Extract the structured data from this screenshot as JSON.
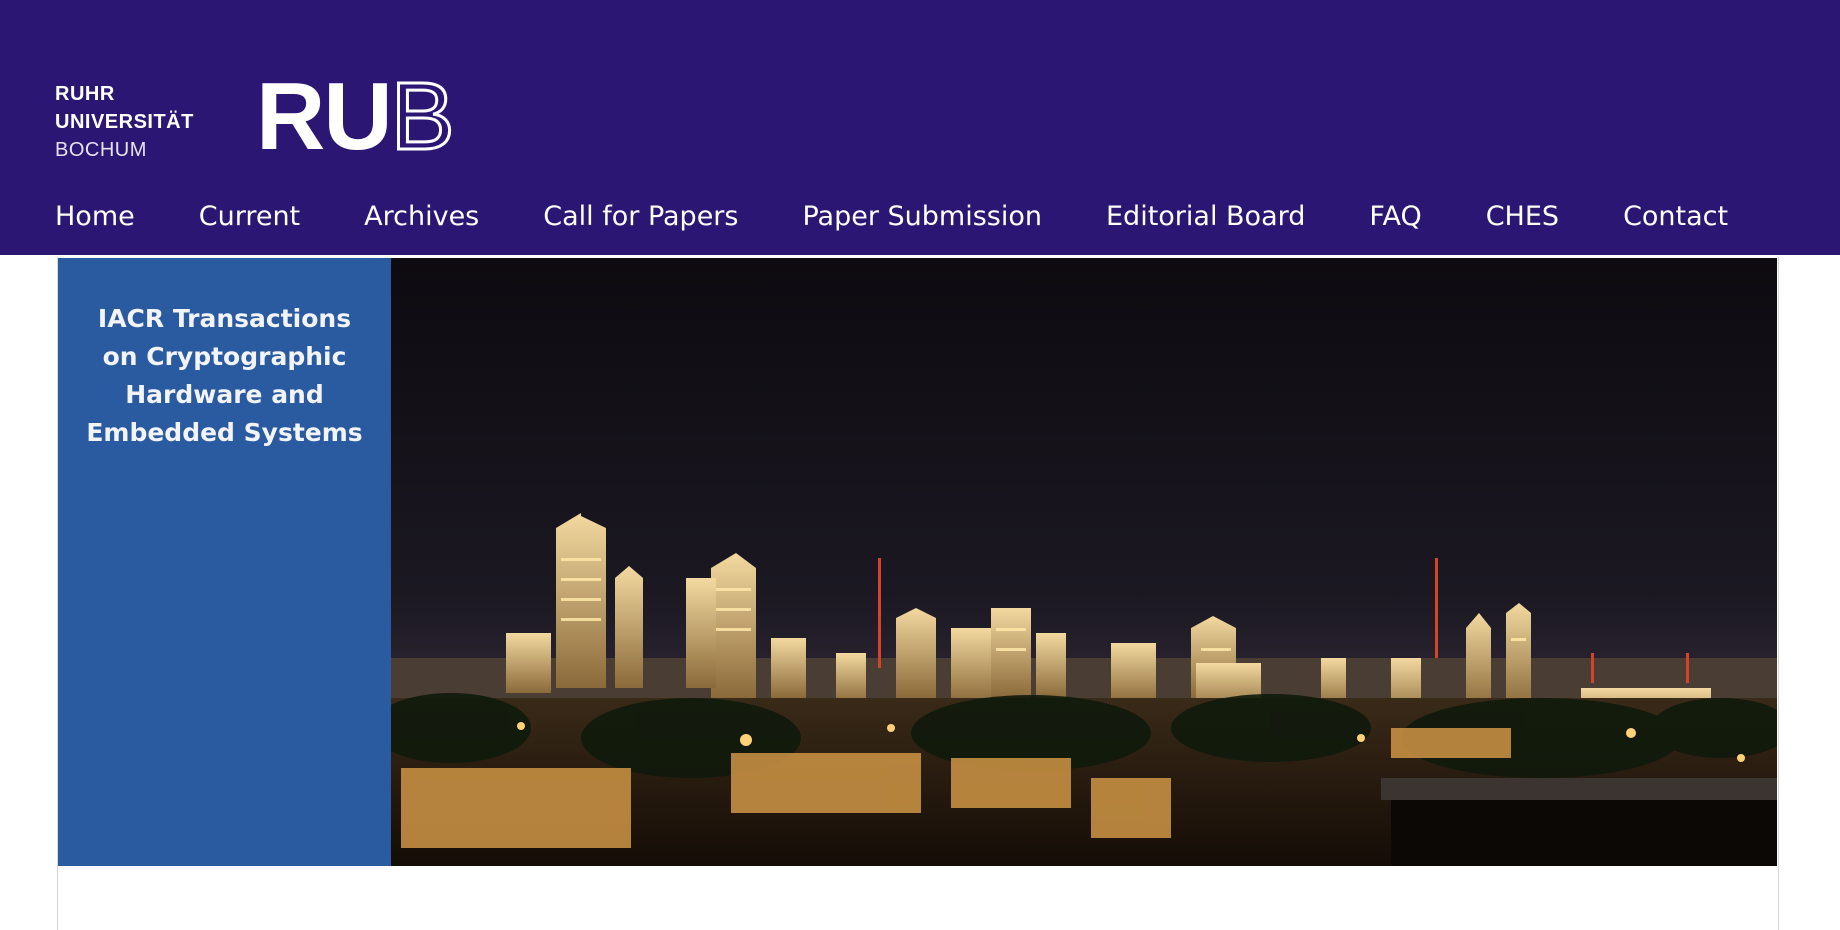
{
  "logo": {
    "wordmark_line1": "RUHR",
    "wordmark_line2": "UNIVERSITÄT",
    "wordmark_line3": "BOCHUM",
    "mark_ru": "RU",
    "mark_b": "B"
  },
  "nav": {
    "items": [
      {
        "label": "Home"
      },
      {
        "label": "Current"
      },
      {
        "label": "Archives"
      },
      {
        "label": "Call for Papers"
      },
      {
        "label": "Paper Submission"
      },
      {
        "label": "Editorial Board"
      },
      {
        "label": "FAQ"
      },
      {
        "label": "CHES"
      },
      {
        "label": "Contact"
      }
    ]
  },
  "banner": {
    "journal_title": "IACR Transactions\non Cryptographic\nHardware and\nEmbedded Systems",
    "image": "city-skyline-night-photo"
  },
  "colors": {
    "header_bg": "#2c1673",
    "banner_side_bg": "#2a5aa0",
    "nav_text": "#ffffff"
  }
}
